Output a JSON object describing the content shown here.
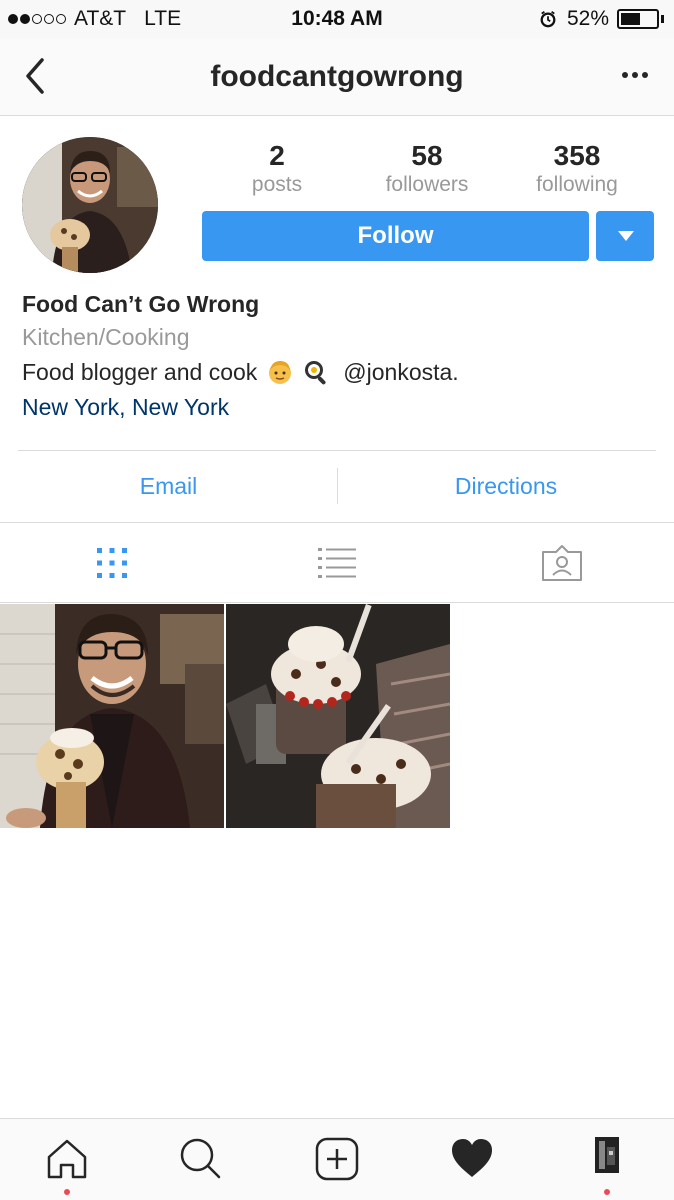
{
  "status_bar": {
    "carrier": "AT&T",
    "network": "LTE",
    "time": "10:48 AM",
    "battery_text": "52%",
    "battery_level": 0.52,
    "signal_bars_filled": 2,
    "signal_bars_total": 5
  },
  "nav": {
    "title": "foodcantgowrong",
    "back_icon": "chevron-left-icon",
    "more_icon": "more-horizontal-icon"
  },
  "profile": {
    "stats": [
      {
        "number": "2",
        "label": "posts"
      },
      {
        "number": "58",
        "label": "followers"
      },
      {
        "number": "358",
        "label": "following"
      }
    ],
    "follow_label": "Follow",
    "name": "Food Can’t Go Wrong",
    "category": "Kitchen/Cooking",
    "bio_text": "Food blogger and cook",
    "bio_mention": "@jonkosta.",
    "location": "New York, New York"
  },
  "contact": {
    "email_label": "Email",
    "directions_label": "Directions"
  },
  "colors": {
    "accent": "#3897f0",
    "link_dark": "#003569",
    "muted": "#999999",
    "divider": "#dbdbdb",
    "notification": "#ed4956"
  }
}
